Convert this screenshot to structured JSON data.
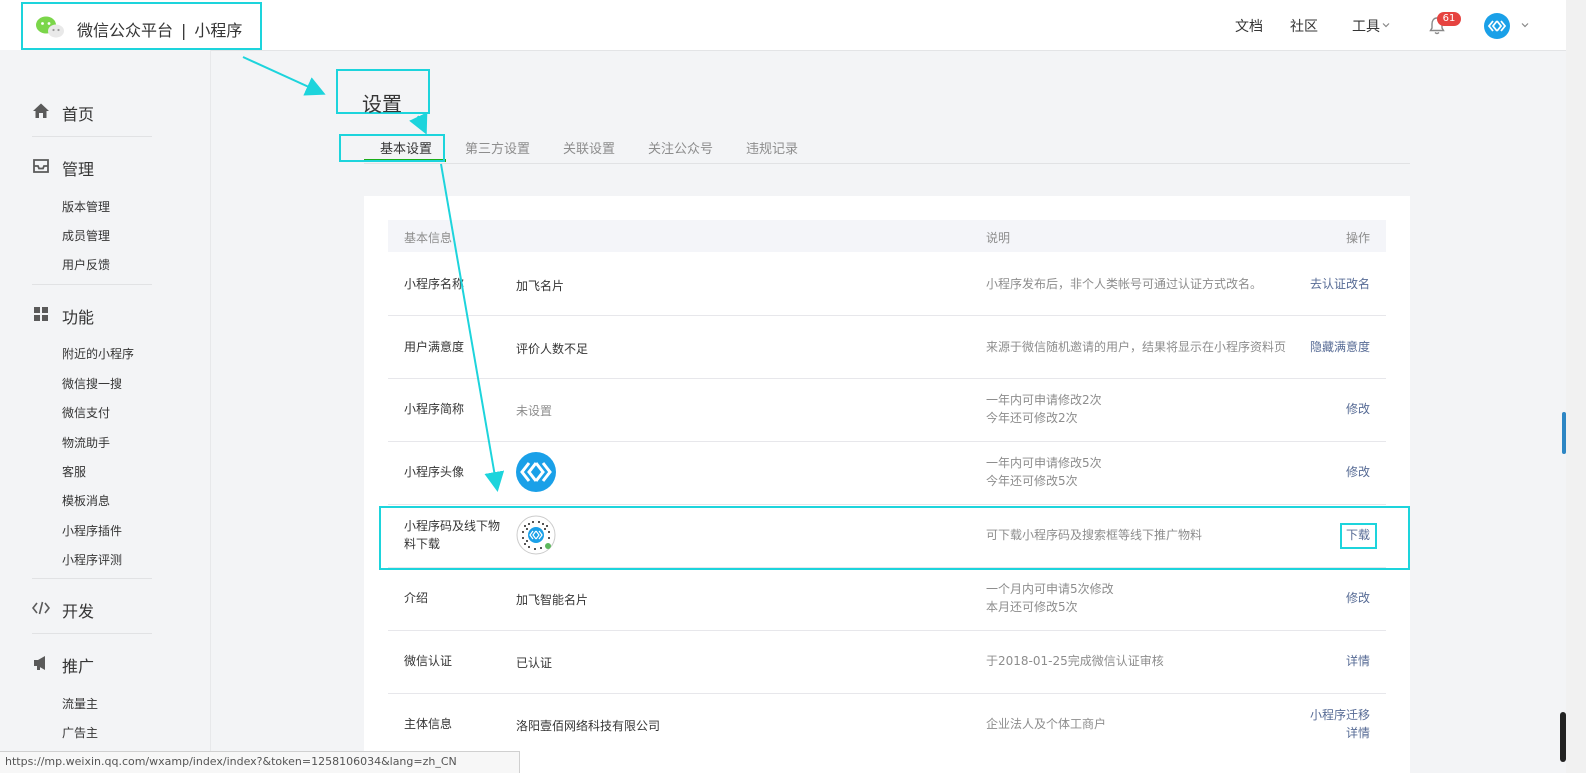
{
  "header": {
    "title": "微信公众平台",
    "separator": "|",
    "subtitle": "小程序",
    "nav": [
      "文档",
      "社区",
      "工具"
    ],
    "notification_count": "61"
  },
  "sidebar": {
    "sections": [
      {
        "label": "首页",
        "icon": "home-icon",
        "items": []
      },
      {
        "label": "管理",
        "icon": "inbox-icon",
        "items": [
          "版本管理",
          "成员管理",
          "用户反馈"
        ]
      },
      {
        "label": "功能",
        "icon": "grid-icon",
        "items": [
          "附近的小程序",
          "微信搜一搜",
          "微信支付",
          "物流助手",
          "客服",
          "模板消息",
          "小程序插件",
          "小程序评测"
        ]
      },
      {
        "label": "开发",
        "icon": "code-icon",
        "items": []
      },
      {
        "label": "推广",
        "icon": "megaphone-icon",
        "items": [
          "流量主",
          "广告主"
        ]
      }
    ]
  },
  "page": {
    "title": "设置",
    "tabs": [
      "基本设置",
      "第三方设置",
      "关联设置",
      "关注公众号",
      "违规记录"
    ],
    "active_tab": 0
  },
  "table": {
    "headers": [
      "基本信息",
      "说明",
      "操作"
    ],
    "rows": [
      {
        "label": "小程序名称",
        "value": "加飞名片",
        "desc": [
          "小程序发布后，非个人类帐号可通过认证方式改名。"
        ],
        "actions": [
          "去认证改名"
        ]
      },
      {
        "label": "用户满意度",
        "value": "评价人数不足",
        "desc": [
          "来源于微信随机邀请的用户，结果将显示在小程序资料页"
        ],
        "actions": [
          "隐藏满意度"
        ]
      },
      {
        "label": "小程序简称",
        "value": "未设置",
        "value_muted": true,
        "desc": [
          "一年内可申请修改2次",
          "今年还可修改2次"
        ],
        "actions": [
          "修改"
        ]
      },
      {
        "label": "小程序头像",
        "value": "",
        "image": "avatar",
        "desc": [
          "一年内可申请修改5次",
          "今年还可修改5次"
        ],
        "actions": [
          "修改"
        ]
      },
      {
        "label": "小程序码及线下物料下载",
        "value": "",
        "image": "qrcode",
        "desc": [
          "可下载小程序码及搜索框等线下推广物料"
        ],
        "actions": [
          "下载"
        ]
      },
      {
        "label": "介绍",
        "value": "加飞智能名片",
        "desc": [
          "一个月内可申请5次修改",
          "本月还可修改5次"
        ],
        "actions": [
          "修改"
        ]
      },
      {
        "label": "微信认证",
        "value": "已认证",
        "desc": [
          "于2018-01-25完成微信认证审核"
        ],
        "actions": [
          "详情"
        ]
      },
      {
        "label": "主体信息",
        "value": "洛阳壹佰网络科技有限公司",
        "desc": [
          "企业法人及个体工商户"
        ],
        "actions": [
          "小程序迁移",
          "详情"
        ]
      }
    ]
  },
  "statusbar": {
    "url": "https://mp.weixin.qq.com/wxamp/index/index?&token=1258106034&lang=zh_CN"
  },
  "colors": {
    "accent": "#1dd4dc",
    "link": "#576b95",
    "green": "#1aad19",
    "badge": "#e64340",
    "brand_blue": "#1aa0e8"
  }
}
